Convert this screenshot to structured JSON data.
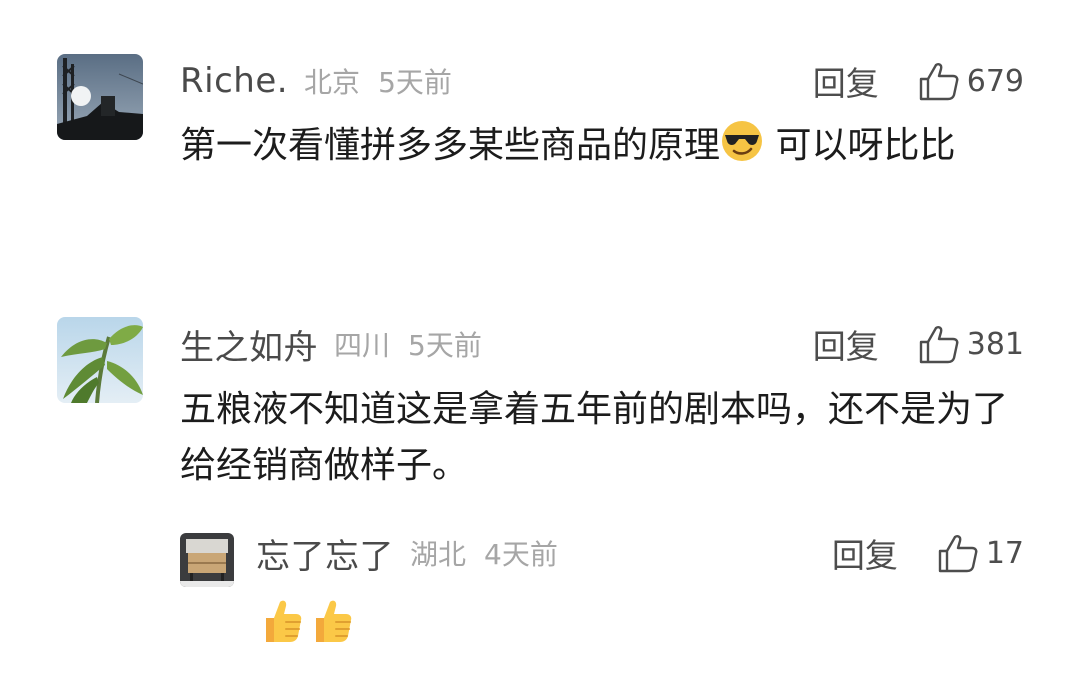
{
  "comments": [
    {
      "user": "Riche.",
      "location": "北京",
      "time": "5天前",
      "reply_label": "回复",
      "likes": "679",
      "text": "第一次看懂拼多多某些商品的原理",
      "text_after_emoji": " 可以呀比比",
      "avatar_icon": "night-tower-avatar"
    },
    {
      "user": "生之如舟",
      "location": "四川",
      "time": "5天前",
      "reply_label": "回复",
      "likes": "381",
      "text": "五粮液不知道这是拿着五年前的剧本吗，还不是为了给经销商做样子。",
      "avatar_icon": "banana-leaf-avatar"
    }
  ],
  "reply": {
    "user": "忘了忘了",
    "location": "湖北",
    "time": "4天前",
    "reply_label": "回复",
    "likes": "17",
    "emoji_icons": [
      "thumbs-up-emoji",
      "thumbs-up-emoji"
    ],
    "avatar_icon": "cabinet-avatar"
  },
  "colors": {
    "name": "#4a4a4a",
    "meta": "#a6a6a6",
    "text": "#1c1c1c",
    "action": "#4d4d4d"
  }
}
